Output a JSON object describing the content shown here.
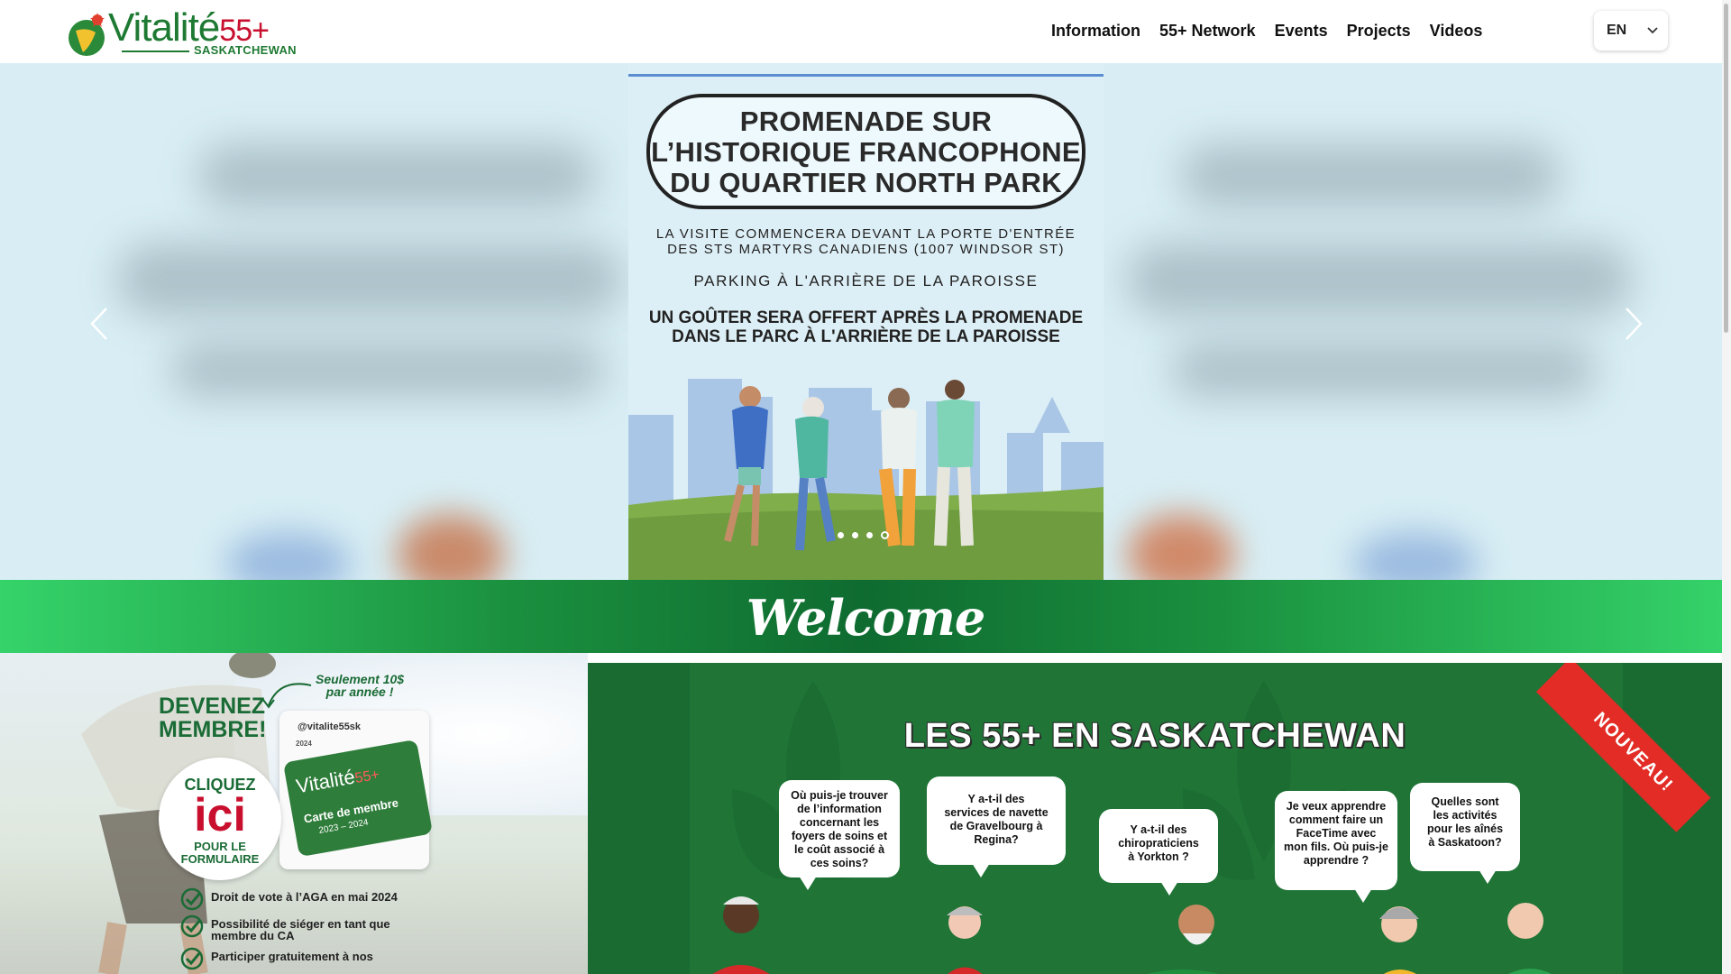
{
  "header": {
    "logo": {
      "word": "Vitalité",
      "number": "55+",
      "region": "SASKATCHEWAN"
    },
    "nav": [
      "Information",
      "55+ Network",
      "Events",
      "Projects",
      "Videos"
    ],
    "language": {
      "code": "EN"
    }
  },
  "hero": {
    "slide": {
      "title_lines": [
        "PROMENADE SUR",
        "L’HISTORIQUE FRANCOPHONE",
        "DU QUARTIER NORTH PARK"
      ],
      "text1_lines": [
        "LA VISITE COMMENCERA DEVANT LA PORTE D'ENTRÉE",
        "DES STS MARTYRS CANADIENS (1007 WINDSOR ST)"
      ],
      "text2": "PARKING À L'ARRIÈRE DE LA PAROISSE",
      "text3_lines": [
        "UN GOÛTER SERA OFFERT APRÈS LA PROMENADE",
        "DANS LE PARC À L'ARRIÈRE DE LA PAROISSE"
      ]
    },
    "slide_count": 4,
    "active_slide": 4
  },
  "welcome": {
    "text": "Welcome"
  },
  "promo": {
    "title_lines": [
      "DEVENEZ",
      "MEMBRE!"
    ],
    "price_lines": [
      "Seulement 10$",
      "par année !"
    ],
    "circle": {
      "line1": "CLIQUEZ",
      "line2": "ici",
      "line3_lines": [
        "POUR LE",
        "FORMULAIRE"
      ]
    },
    "card": {
      "handle": "@vitalite55sk",
      "logo": "Vitalité",
      "logo_number": "55+",
      "label": "Carte de membre",
      "years": "2023 – 2024",
      "tab_year": "2024"
    },
    "benefits": [
      "Droit de vote à l’AGA en mai 2024",
      "Possibilité de siéger en tant que membre du CA",
      "Participer gratuitement à nos"
    ]
  },
  "banner": {
    "title": "LES 55+ EN SASKATCHEWAN",
    "ribbon": "NOUVEAU!",
    "bubbles": [
      [
        "Où puis-je trouver",
        "de l’information",
        "concernant les",
        "foyers de soins et",
        "le coût associé à",
        "ces soins?"
      ],
      [
        "Y a-t-il des",
        "services de navette",
        "de Gravelbourg à",
        "Regina?"
      ],
      [
        "Y a-t-il des",
        "chiropraticiens",
        "à Yorkton ?"
      ],
      [
        "Je veux apprendre",
        "comment faire un",
        "FaceTime avec",
        "mon fils. Où puis-je",
        "apprendre ?"
      ],
      [
        "Quelles sont",
        "les activités",
        "pour les aînés",
        "à Saskatoon?"
      ]
    ]
  },
  "colors": {
    "brand_green": "#1e7a33",
    "brand_red": "#c8102e",
    "welcome_green_dark": "#0f6b30",
    "welcome_green_light": "#35d36a",
    "ribbon_red": "#e22c25"
  }
}
